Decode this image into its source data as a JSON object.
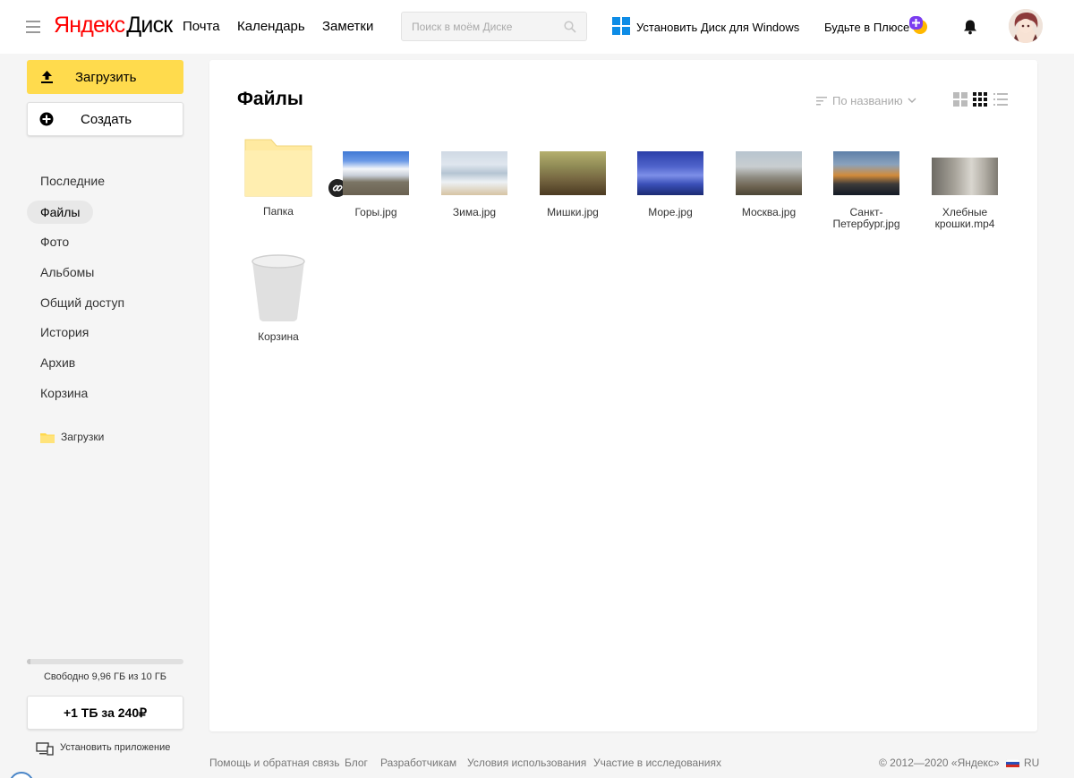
{
  "header": {
    "logo_ya": "Яндекс",
    "logo_disk": "Диск",
    "nav": [
      "Почта",
      "Календарь",
      "Заметки"
    ],
    "search_placeholder": "Поиск в моём Диске",
    "install_windows": "Установить Диск для Windows",
    "plus_promo": "Будьте в Плюсе",
    "icons": [
      "menu-icon",
      "search-icon",
      "windows-icon",
      "plus-icon",
      "bell-icon",
      "avatar"
    ]
  },
  "sidebar": {
    "upload_label": "Загрузить",
    "create_label": "Создать",
    "items": [
      "Последние",
      "Файлы",
      "Фото",
      "Альбомы",
      "Общий доступ",
      "История",
      "Архив",
      "Корзина"
    ],
    "active_item": "Файлы",
    "folder_label": "Загрузки",
    "quota_text": "Свободно 9,96 ГБ из 10 ГБ",
    "quota_used_fraction": 0.004,
    "buy_label": "+1 ТБ за 240₽",
    "install_app_label": "Установить приложение"
  },
  "main": {
    "title": "Файлы",
    "sort_label": "По названию",
    "view_modes": [
      "large-tiles",
      "small-tiles",
      "list"
    ],
    "active_view": "small-tiles",
    "files": [
      {
        "name": "Папка",
        "type": "folder",
        "shared": true
      },
      {
        "name": "Горы.jpg",
        "type": "image",
        "colors": [
          "#3f78d4",
          "#f4f6fa",
          "#6a6151"
        ]
      },
      {
        "name": "Зима.jpg",
        "type": "image",
        "colors": [
          "#cfd9e4",
          "#edf1f5",
          "#d6c3a3"
        ]
      },
      {
        "name": "Мишки.jpg",
        "type": "image",
        "colors": [
          "#b5b06e",
          "#7a6b44",
          "#4b3a22"
        ]
      },
      {
        "name": "Море.jpg",
        "type": "image",
        "colors": [
          "#2a3ea8",
          "#7d8fe8",
          "#1b2a73"
        ]
      },
      {
        "name": "Москва.jpg",
        "type": "image",
        "colors": [
          "#b7c4cf",
          "#8d8a80",
          "#4b4535"
        ]
      },
      {
        "name": "Санкт-Петербург.jpg",
        "type": "image",
        "colors": [
          "#5d7fa8",
          "#d28b3a",
          "#141a25"
        ]
      },
      {
        "name": "Хлебные крошки.mp4",
        "type": "video",
        "colors": [
          "#a7a39a",
          "#d9d6cf",
          "#6d6a64"
        ]
      },
      {
        "name": "Корзина",
        "type": "trash"
      }
    ]
  },
  "footer": {
    "links": [
      "Помощь и обратная связь",
      "Блог",
      "Разработчикам",
      "Условия использования",
      "Участие в исследованиях"
    ],
    "copyright": "© 2012—2020 «Яндекс»",
    "lang": "RU"
  },
  "colors": {
    "accent_yellow": "#ffdb4d",
    "logo_red": "#ff0000",
    "folder_yellow": "#ffeaa1",
    "windows_blue": "#0d8ce6"
  }
}
